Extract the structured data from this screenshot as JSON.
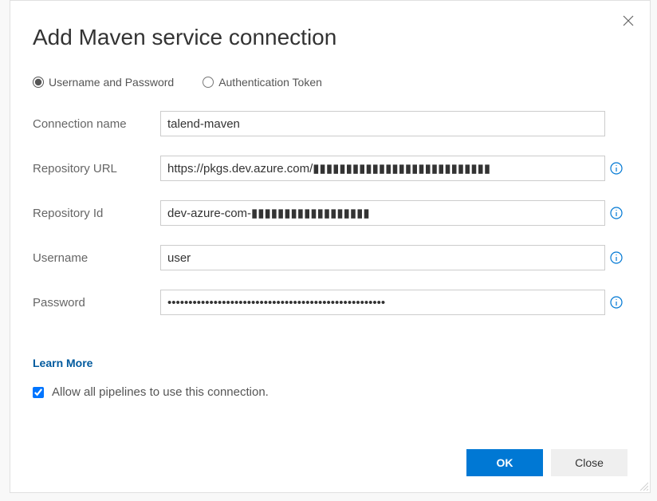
{
  "dialog": {
    "title": "Add Maven service connection"
  },
  "auth_type": {
    "options": [
      {
        "label": "Username and Password",
        "value": "userpass",
        "selected": true
      },
      {
        "label": "Authentication Token",
        "value": "token",
        "selected": false
      }
    ]
  },
  "fields": {
    "connection_name": {
      "label": "Connection name",
      "value": "talend-maven"
    },
    "repository_url": {
      "label": "Repository URL",
      "value": "https://pkgs.dev.azure.com/▮▮▮▮▮▮▮▮▮▮▮▮▮▮▮▮▮▮▮▮▮▮▮▮▮▮▮"
    },
    "repository_id": {
      "label": "Repository Id",
      "value": "dev-azure-com-▮▮▮▮▮▮▮▮▮▮▮▮▮▮▮▮▮▮"
    },
    "username": {
      "label": "Username",
      "value": "user"
    },
    "password": {
      "label": "Password",
      "value": "••••••••••••••••••••••••••••••••••••••••••••••••••••"
    }
  },
  "learn_more": "Learn More",
  "allow_all": {
    "label": "Allow all pipelines to use this connection.",
    "checked": true
  },
  "buttons": {
    "ok": "OK",
    "close": "Close"
  }
}
